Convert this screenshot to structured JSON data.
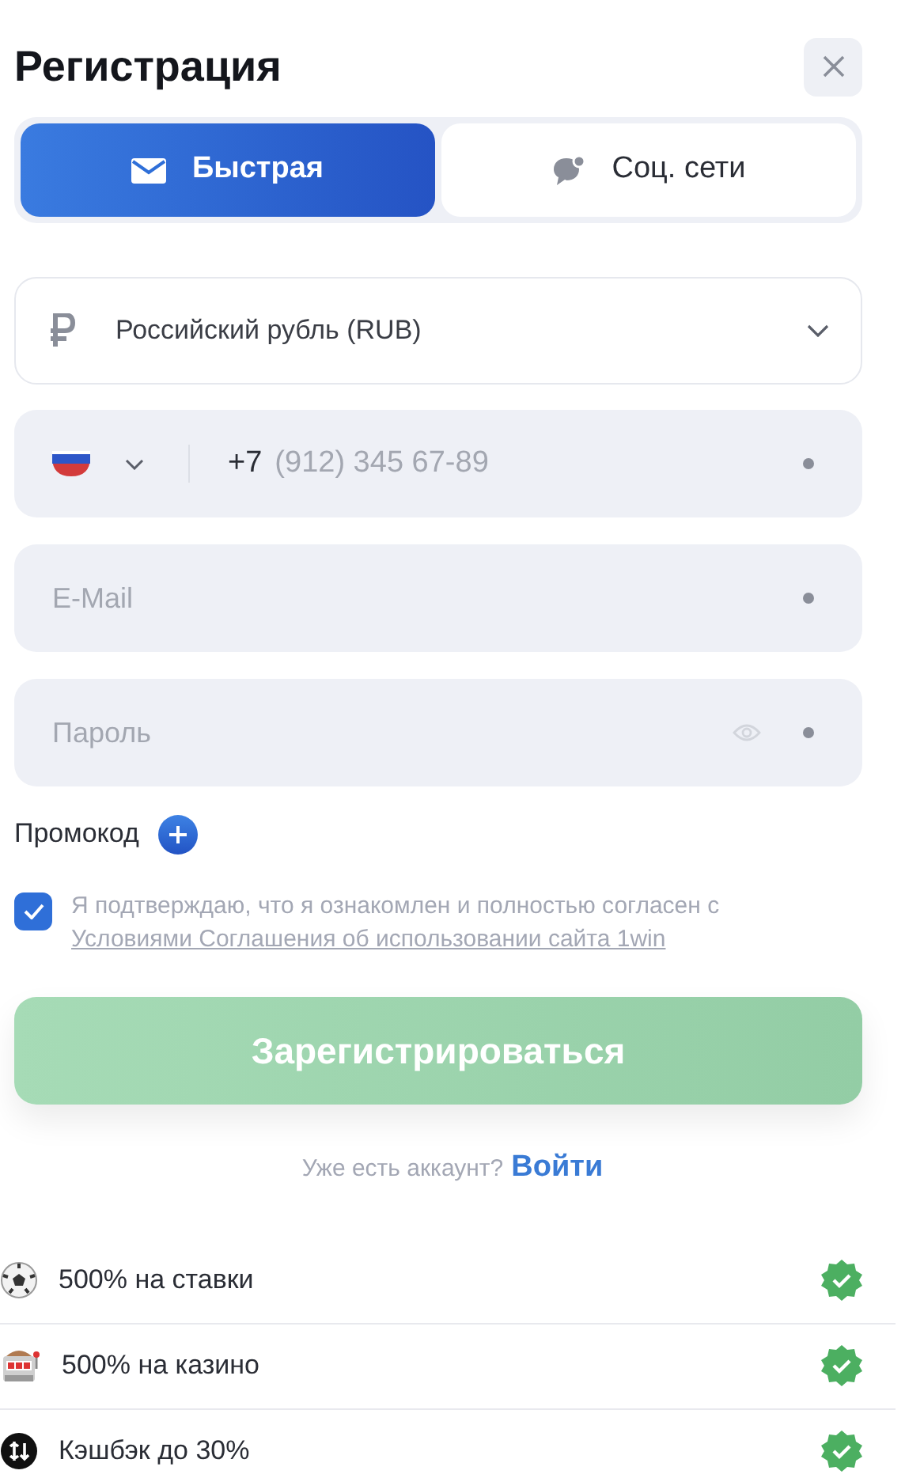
{
  "title": "Регистрация",
  "tabs": [
    {
      "label": "Быстрая",
      "kind": "mail",
      "selected": true
    },
    {
      "label": "Соц. сети",
      "kind": "chat",
      "selected": false
    }
  ],
  "currency": {
    "value": "Российский рубль (RUB)"
  },
  "phone": {
    "prefix": "+7",
    "placeholder": "(912) 345 67-89",
    "required": true
  },
  "email": {
    "placeholder": "E-Mail",
    "required": true
  },
  "password": {
    "placeholder": "Пароль",
    "required": true
  },
  "promo": {
    "label": "Промокод"
  },
  "agreement": {
    "checked": true,
    "text": "Я подтверждаю, что я ознакомлен и полностью согласен с",
    "link": "Условиями Соглашения об использовании сайта 1win"
  },
  "submit": {
    "label": "Зарегистрироваться",
    "disabled": true
  },
  "login": {
    "prompt": "Уже есть аккаунт?",
    "link": "Войти"
  },
  "bonuses": [
    {
      "kind": "ball",
      "label": "500% на ставки",
      "checked": true
    },
    {
      "kind": "slot",
      "label": "500% на казино",
      "checked": true
    },
    {
      "kind": "cashback",
      "label": "Кэшбэк до 30%",
      "checked": true
    }
  ]
}
